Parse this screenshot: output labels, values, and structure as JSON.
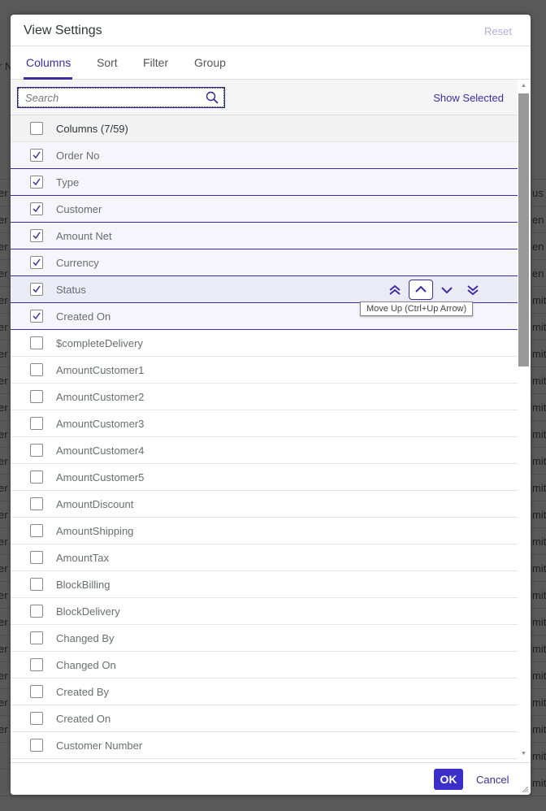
{
  "background": {
    "left_fragments": [
      "r N",
      "er",
      "er",
      "er",
      "er",
      "er",
      "er",
      "er",
      "er",
      "er",
      "er",
      "er",
      "er",
      "er",
      "er",
      "er",
      "er",
      "er",
      "er",
      "er",
      "er",
      "er"
    ],
    "right_fragments": [
      "",
      "us",
      "en",
      "en",
      "en",
      "mit",
      "mit",
      "mit",
      "mit",
      "mit",
      "mit",
      "mit",
      "mit",
      "mit",
      "mit",
      "mit",
      "mit",
      "mit",
      "mit",
      "mit",
      "mit",
      "mit",
      "mit",
      "mit"
    ]
  },
  "dialog": {
    "title": "View Settings",
    "reset_label": "Reset",
    "tabs": [
      {
        "label": "Columns",
        "active": true
      },
      {
        "label": "Sort"
      },
      {
        "label": "Filter"
      },
      {
        "label": "Group"
      }
    ],
    "search": {
      "placeholder": "Search",
      "value": ""
    },
    "show_selected_label": "Show Selected",
    "list_header": "Columns (7/59)",
    "items": [
      {
        "label": "Order No",
        "checked": true
      },
      {
        "label": "Type",
        "checked": true
      },
      {
        "label": "Customer",
        "checked": true
      },
      {
        "label": "Amount Net",
        "checked": true
      },
      {
        "label": "Currency",
        "checked": true
      },
      {
        "label": "Status",
        "checked": true,
        "highlighted": true
      },
      {
        "label": "Created On",
        "checked": true
      },
      {
        "label": "$completeDelivery",
        "checked": false
      },
      {
        "label": "AmountCustomer1",
        "checked": false
      },
      {
        "label": "AmountCustomer2",
        "checked": false
      },
      {
        "label": "AmountCustomer3",
        "checked": false
      },
      {
        "label": "AmountCustomer4",
        "checked": false
      },
      {
        "label": "AmountCustomer5",
        "checked": false
      },
      {
        "label": "AmountDiscount",
        "checked": false
      },
      {
        "label": "AmountShipping",
        "checked": false
      },
      {
        "label": "AmountTax",
        "checked": false
      },
      {
        "label": "BlockBilling",
        "checked": false
      },
      {
        "label": "BlockDelivery",
        "checked": false
      },
      {
        "label": "Changed By",
        "checked": false
      },
      {
        "label": "Changed On",
        "checked": false
      },
      {
        "label": "Created By",
        "checked": false
      },
      {
        "label": "Created On",
        "checked": false
      },
      {
        "label": "Customer Number",
        "checked": false
      }
    ],
    "move_buttons": [
      "move-to-top-icon",
      "move-up-icon",
      "move-down-icon",
      "move-to-bottom-icon"
    ],
    "tooltip": "Move Up (Ctrl+Up Arrow)",
    "ok_label": "OK",
    "cancel_label": "Cancel"
  },
  "colors": {
    "accent": "#3b2ea0",
    "ok_bg": "#3b2ec9",
    "overlay": "#595959"
  }
}
